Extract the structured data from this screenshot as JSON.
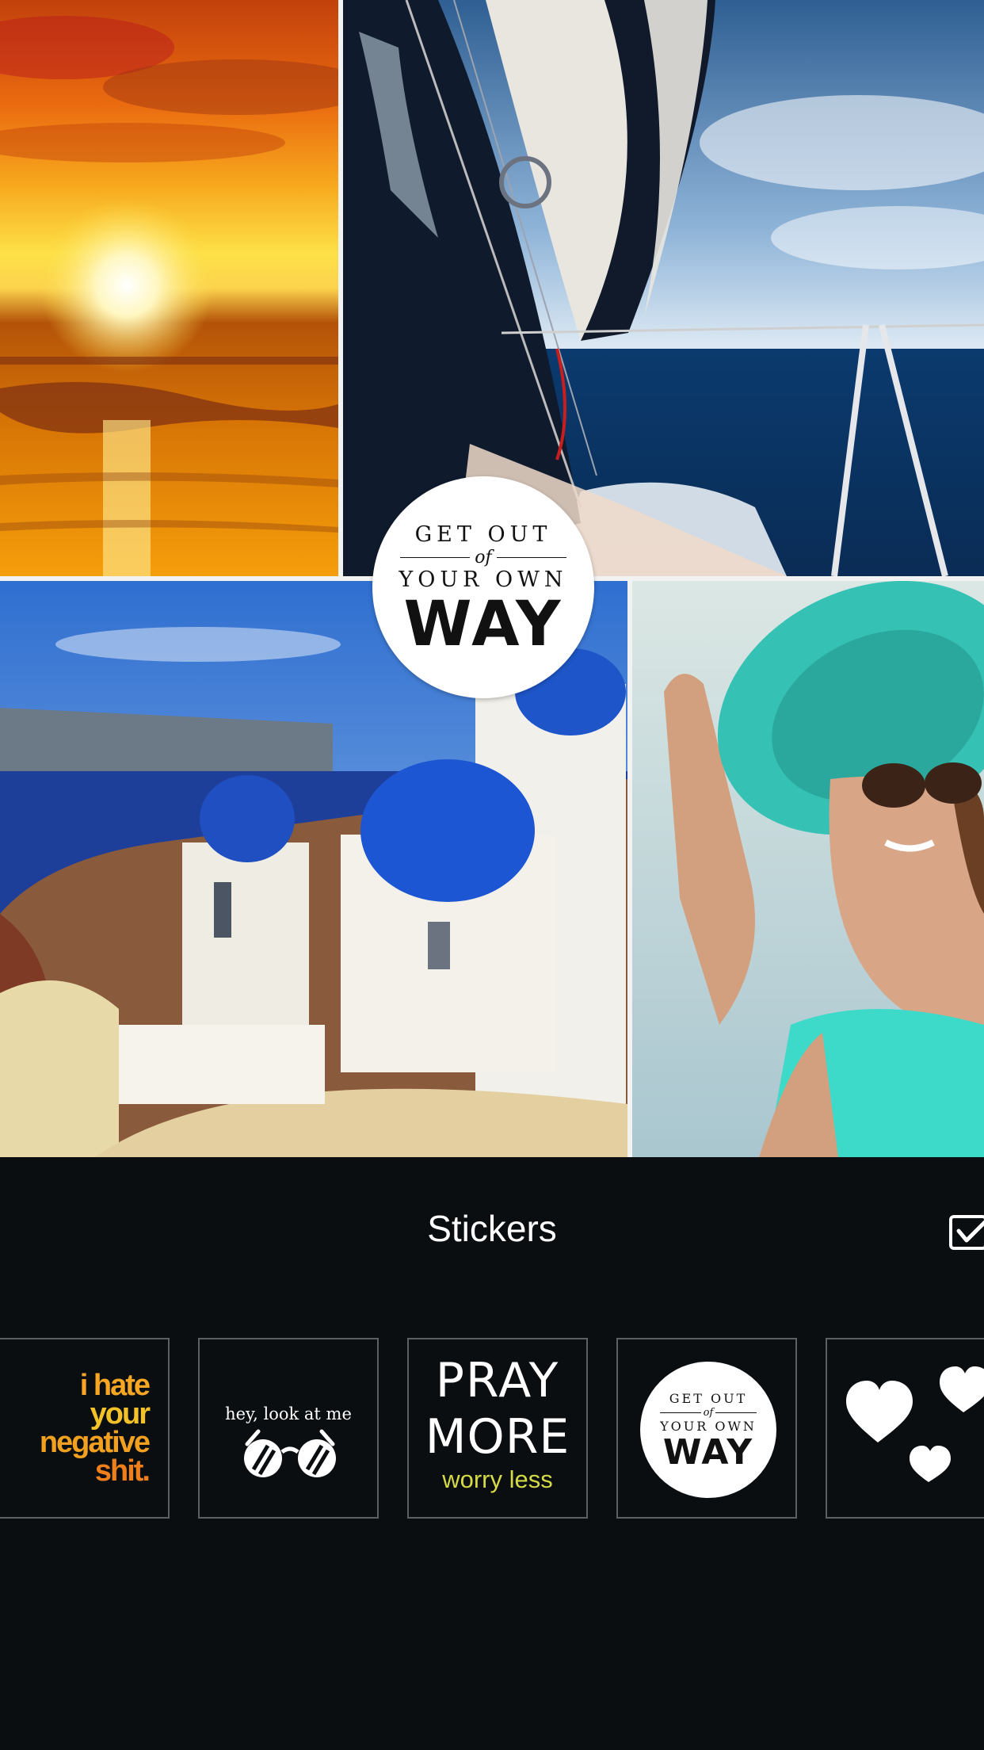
{
  "canvas_sticker": {
    "line1": "GET OUT",
    "line2": "of",
    "line3": "YOUR OWN",
    "line4": "WAY"
  },
  "panel": {
    "title": "Stickers",
    "confirm_icon": "checkbox-check-icon"
  },
  "stickers": [
    {
      "name": "i-hate-your-negative-shit",
      "lines": [
        "i hate",
        "your",
        "negative",
        "shit."
      ],
      "colors": [
        "#f6a623",
        "#f3c229",
        "#f2a01f",
        "#ee7f1b"
      ]
    },
    {
      "name": "hey-look-at-me",
      "text": "hey, look at me",
      "icon": "sunglasses-icon"
    },
    {
      "name": "pray-more-worry-less",
      "line1": "PRAY",
      "line2": "MORE",
      "line3": "worry less",
      "accent": "#d4d946"
    },
    {
      "name": "get-out-of-your-own-way",
      "line1": "GET OUT",
      "line2": "of",
      "line3": "YOUR OWN",
      "line4": "WAY"
    },
    {
      "name": "hearts",
      "icon": "hearts-icon"
    }
  ],
  "photos": [
    "sunset-beach",
    "sailboat-sail",
    "santorini-domes",
    "woman-in-turquoise-hat"
  ]
}
